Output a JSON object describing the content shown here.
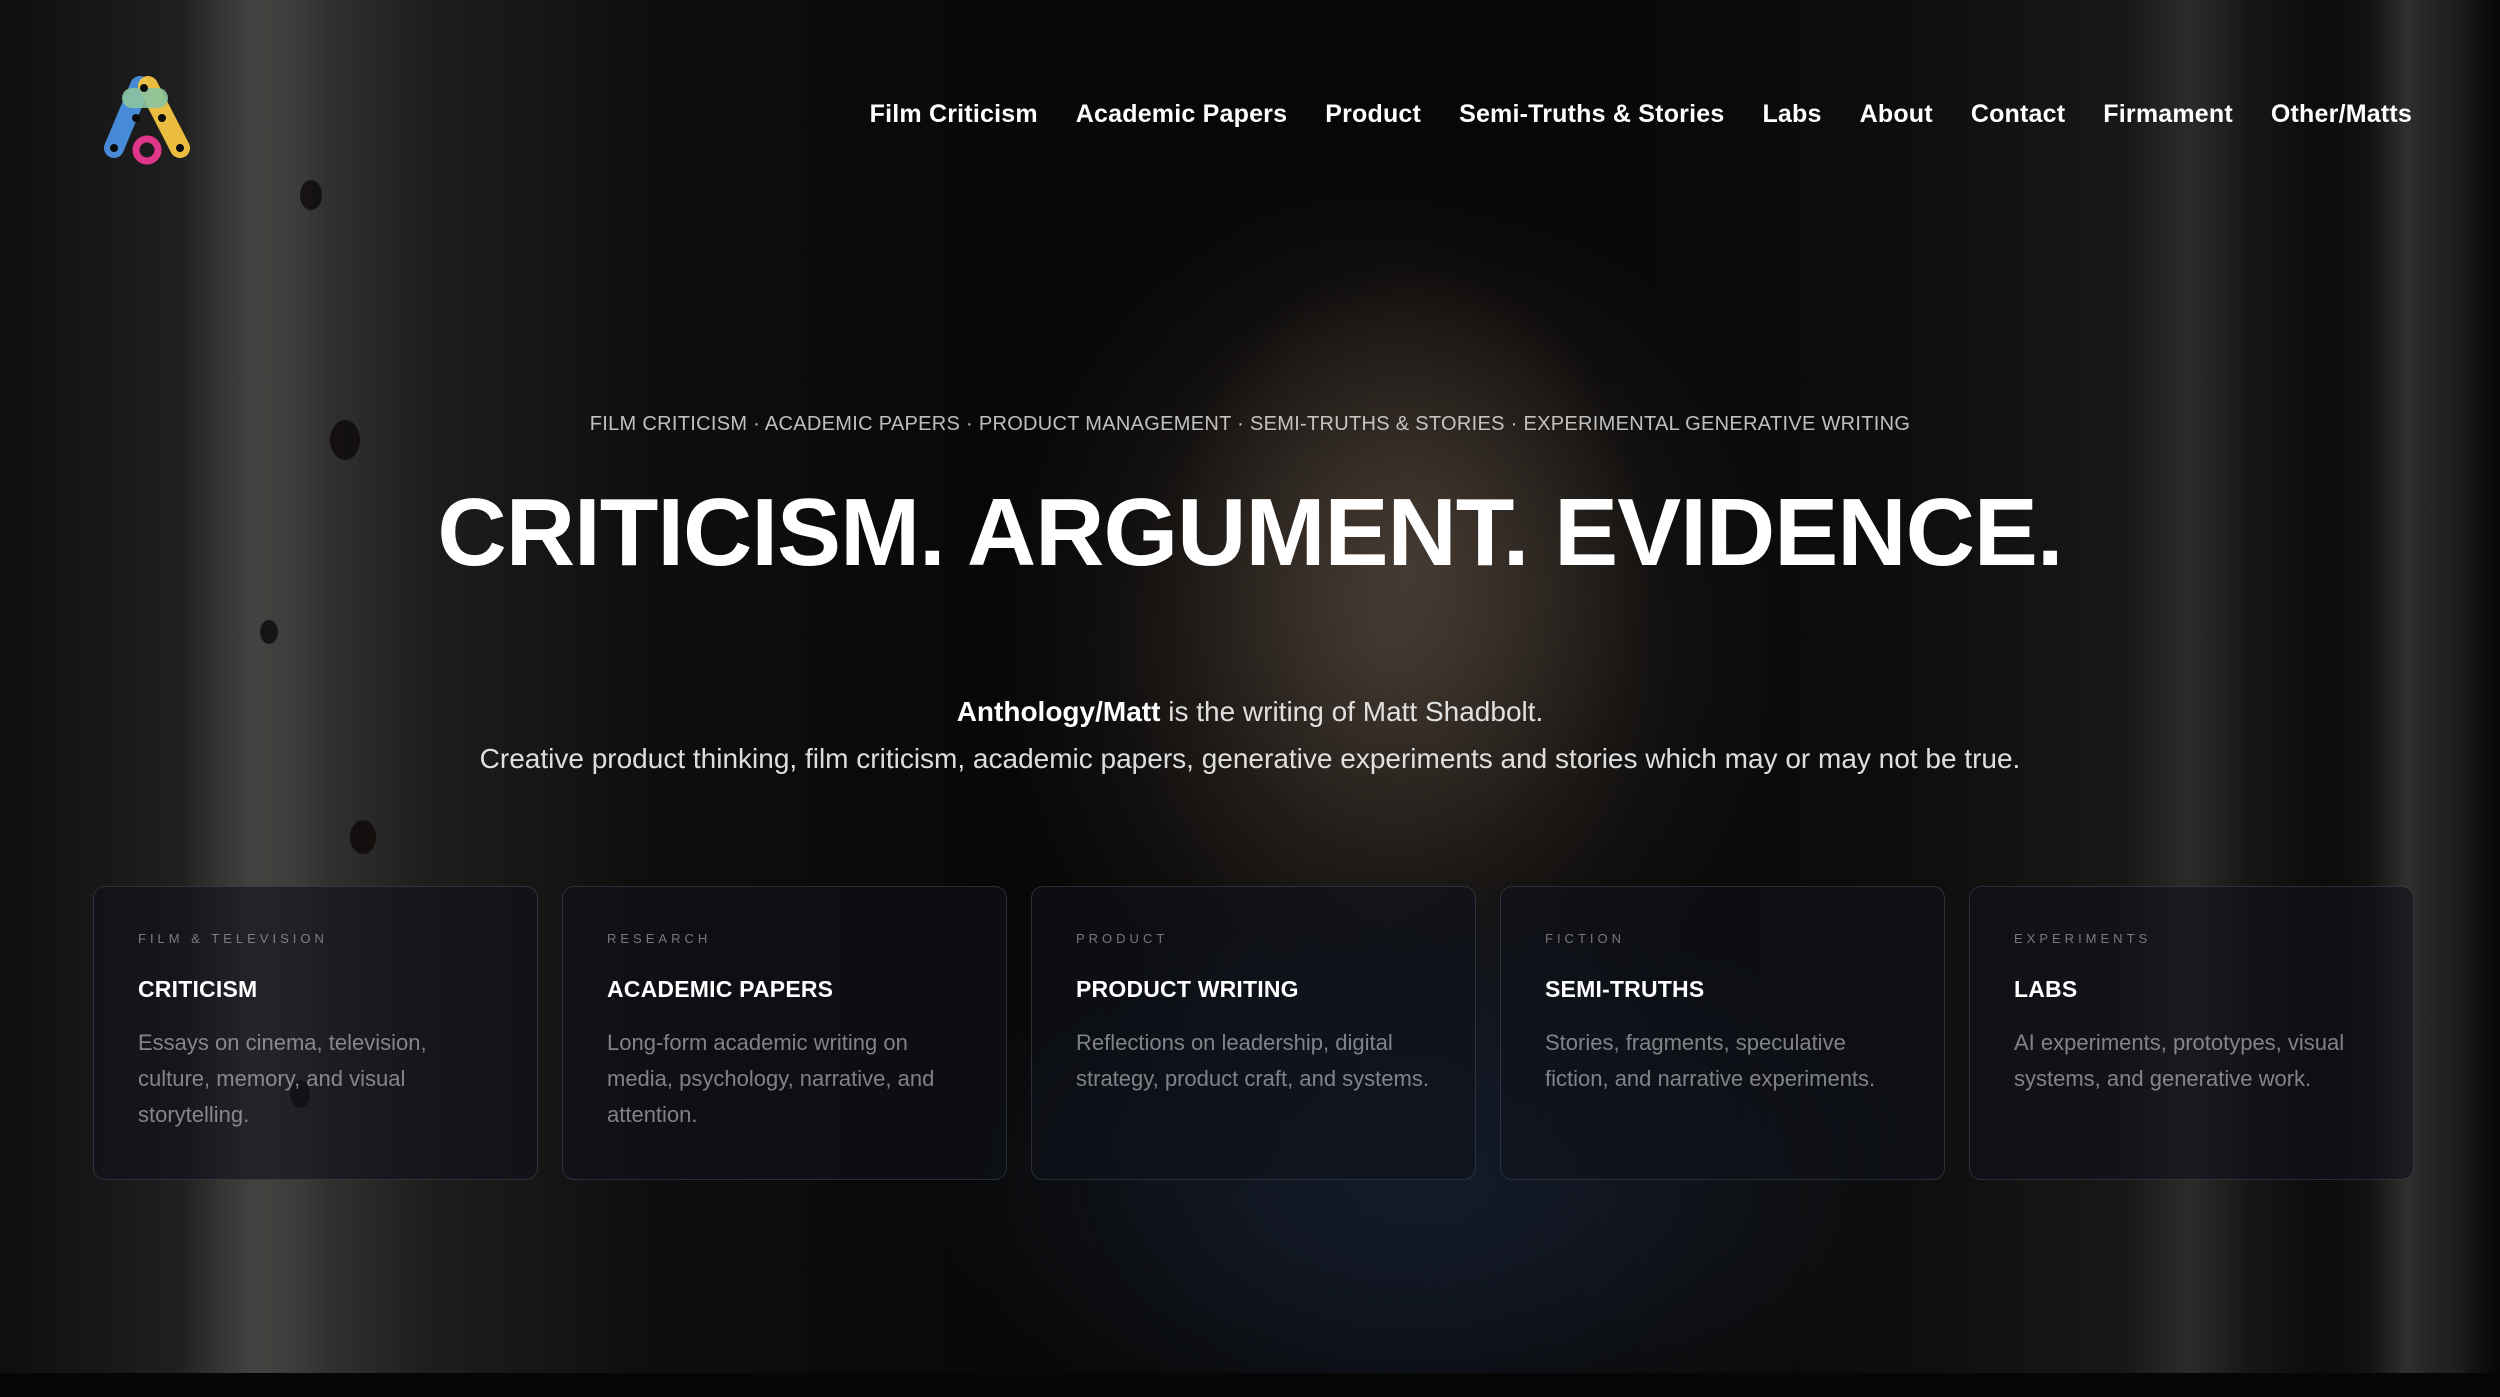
{
  "nav": [
    {
      "label": "Film Criticism"
    },
    {
      "label": "Academic Papers"
    },
    {
      "label": "Product"
    },
    {
      "label": "Semi-Truths & Stories"
    },
    {
      "label": "Labs"
    },
    {
      "label": "About"
    },
    {
      "label": "Contact"
    },
    {
      "label": "Firmament"
    },
    {
      "label": "Other/Matts"
    }
  ],
  "hero": {
    "kicker": "FILM CRITICISM · ACADEMIC PAPERS · PRODUCT MANAGEMENT · SEMI-TRUTHS & STORIES · EXPERIMENTAL GENERATIVE WRITING",
    "headline": "CRITICISM. ARGUMENT. EVIDENCE.",
    "intro_brand": "Anthology/Matt",
    "intro_line1_rest": " is the writing of Matt Shadbolt.",
    "intro_line2": "Creative product thinking, film criticism, academic papers, generative experiments and stories which may or may not be true."
  },
  "cards": [
    {
      "eyebrow": "FILM & TELEVISION",
      "title": "CRITICISM",
      "desc": "Essays on cinema, television, culture, memory, and visual storytelling."
    },
    {
      "eyebrow": "RESEARCH",
      "title": "ACADEMIC PAPERS",
      "desc": "Long-form academic writing on media, psychology, narrative, and attention."
    },
    {
      "eyebrow": "PRODUCT",
      "title": "PRODUCT WRITING",
      "desc": "Reflections on leadership, digital strategy, product craft, and systems."
    },
    {
      "eyebrow": "FICTION",
      "title": "SEMI-TRUTHS",
      "desc": "Stories, fragments, speculative fiction, and narrative experiments."
    },
    {
      "eyebrow": "EXPERIMENTS",
      "title": "LABS",
      "desc": "AI experiments, prototypes, visual systems, and generative work."
    }
  ],
  "colors": {
    "logo_blue": "#4a90e2",
    "logo_green": "#8bc4a0",
    "logo_yellow": "#f5c542",
    "logo_pink": "#e0368a"
  }
}
